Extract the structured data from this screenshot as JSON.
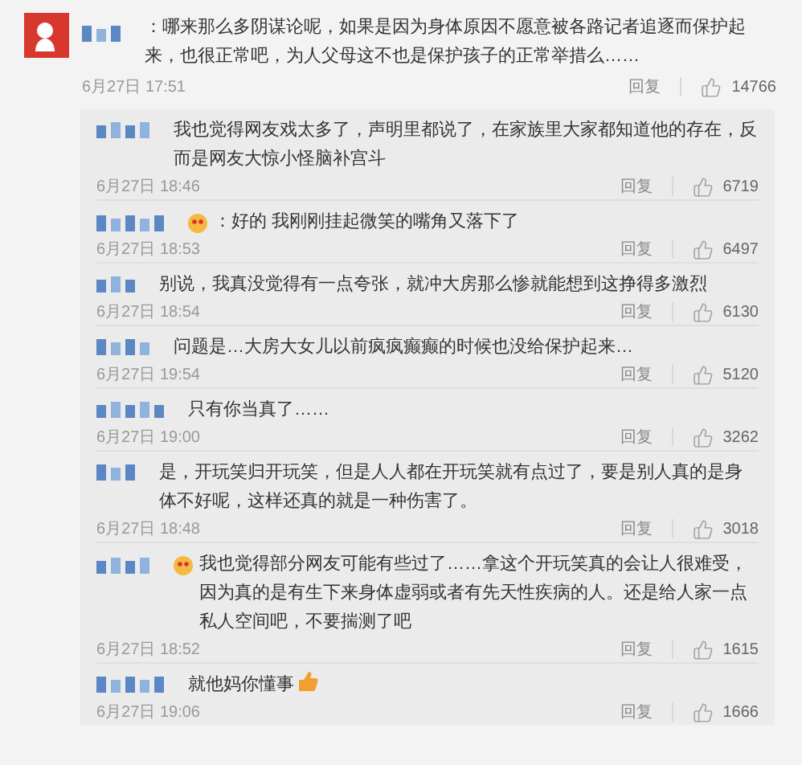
{
  "comment": {
    "text": "：哪来那么多阴谋论呢，如果是因为身体原因不愿意被各路记者追逐而保护起来，也很正常吧，为人父母这不也是保护孩子的正常举措么……",
    "time": "6月27日 17:51",
    "reply_label": "回复",
    "likes": "14766"
  },
  "replies": [
    {
      "text": "我也觉得网友戏太多了，声明里都说了，在家族里大家都知道他的存在，反而是网友大惊小怪脑补宫斗",
      "time": "6月27日 18:46",
      "reply_label": "回复",
      "likes": "6719",
      "name_emoji": false,
      "end_emoji": false
    },
    {
      "text": "：好的 我刚刚挂起微笑的嘴角又落下了",
      "time": "6月27日 18:53",
      "reply_label": "回复",
      "likes": "6497",
      "name_emoji": true,
      "end_emoji": false
    },
    {
      "text": "别说，我真没觉得有一点夸张，就冲大房那么惨就能想到这挣得多激烈",
      "time": "6月27日 18:54",
      "reply_label": "回复",
      "likes": "6130",
      "name_emoji": false,
      "end_emoji": false
    },
    {
      "text": "问题是…大房大女儿以前疯疯癫癫的时候也没给保护起来…",
      "time": "6月27日 19:54",
      "reply_label": "回复",
      "likes": "5120",
      "name_emoji": false,
      "end_emoji": false
    },
    {
      "text": "只有你当真了……",
      "time": "6月27日 19:00",
      "reply_label": "回复",
      "likes": "3262",
      "name_emoji": false,
      "end_emoji": false
    },
    {
      "text": "是，开玩笑归开玩笑，但是人人都在开玩笑就有点过了，要是别人真的是身体不好呢，这样还真的就是一种伤害了。",
      "time": "6月27日 18:48",
      "reply_label": "回复",
      "likes": "3018",
      "name_emoji": false,
      "end_emoji": false
    },
    {
      "text": "我也觉得部分网友可能有些过了……拿这个开玩笑真的会让人很难受，因为真的是有生下来身体虚弱或者有先天性疾病的人。还是给人家一点私人空间吧，不要揣测了吧",
      "time": "6月27日 18:52",
      "reply_label": "回复",
      "likes": "1615",
      "name_emoji": true,
      "end_emoji": false
    },
    {
      "text": "就他妈你懂事",
      "time": "6月27日 19:06",
      "reply_label": "回复",
      "likes": "1666",
      "name_emoji": false,
      "end_emoji": true
    }
  ]
}
